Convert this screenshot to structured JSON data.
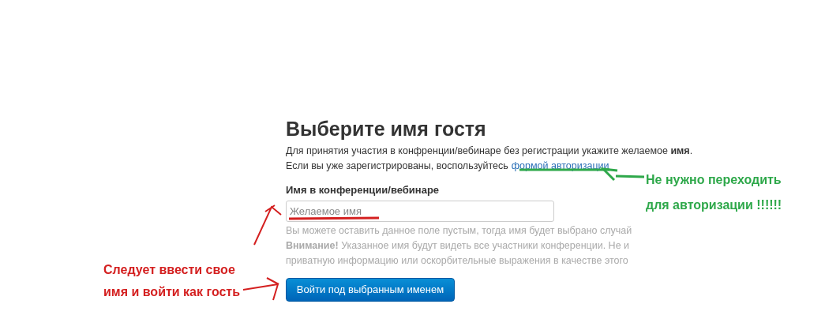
{
  "heading": "Выберите имя гостя",
  "intro": "Для принятия участия в конфренции/вебинаре без регистрации укажите желаемое **имя**.",
  "login_prefix": "Если вы уже зарегистрированы, воспользуйтесь",
  "login_link": "формой авторизации",
  "field": {
    "label": "Имя в конференции/вебинаре",
    "placeholder": "Желаемое имя"
  },
  "hint_lines": [
    "Вы можете оставить данное поле пустым, тогда имя будет выбрано случай",
    "**Внимание!** Указанное имя будут видеть все участники конференции. Не и",
    "приватную информацию или оскорбительные выражения в качестве этого"
  ],
  "submit_button": "Войти под выбранным именем",
  "annotations": [
    {
      "kind": "red",
      "lines": [
        "Следует ввести свое",
        "имя и войти как гость"
      ]
    },
    {
      "kind": "green",
      "lines": [
        "Не нужно переходить",
        "для авторизации !!!!!!"
      ]
    }
  ]
}
